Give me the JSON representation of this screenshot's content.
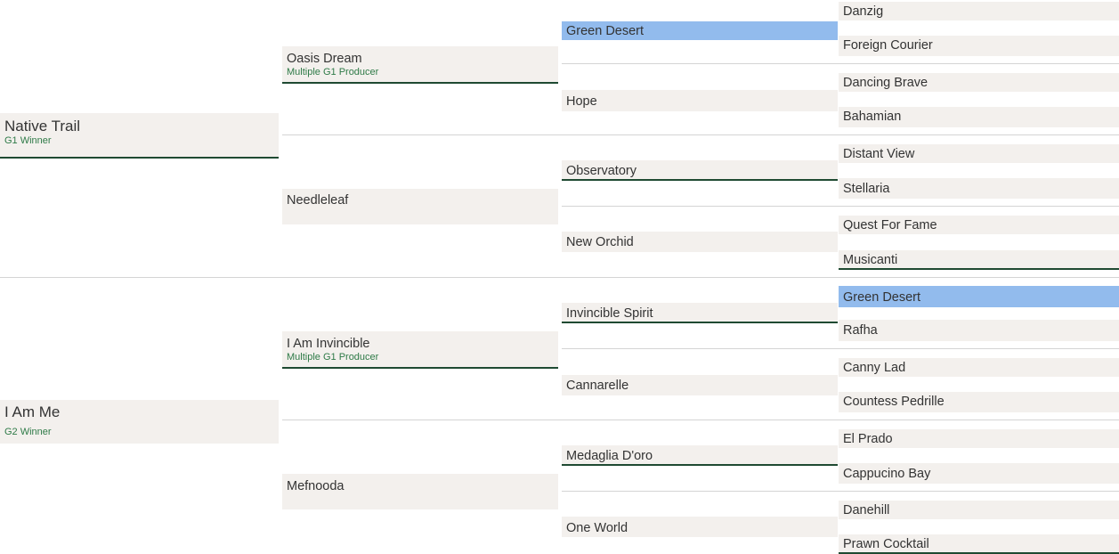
{
  "pedigree": {
    "sire": {
      "name": "Native Trail",
      "note": "G1 Winner"
    },
    "dam": {
      "name": "I Am Me",
      "note": "G2 Winner"
    },
    "sire_sire": {
      "name": "Oasis Dream",
      "note": "Multiple G1 Producer"
    },
    "sire_dam": {
      "name": "Needleleaf"
    },
    "dam_sire": {
      "name": "I Am Invincible",
      "note": "Multiple G1 Producer"
    },
    "dam_dam": {
      "name": "Mefnooda"
    },
    "generation3": [
      {
        "name": "Green Desert"
      },
      {
        "name": "Hope"
      },
      {
        "name": "Observatory"
      },
      {
        "name": "New Orchid"
      },
      {
        "name": "Invincible Spirit"
      },
      {
        "name": "Cannarelle"
      },
      {
        "name": "Medaglia D'oro"
      },
      {
        "name": "One World"
      }
    ],
    "generation4": [
      {
        "name": "Danzig"
      },
      {
        "name": "Foreign Courier"
      },
      {
        "name": "Dancing Brave"
      },
      {
        "name": "Bahamian"
      },
      {
        "name": "Distant View"
      },
      {
        "name": "Stellaria"
      },
      {
        "name": "Quest For Fame"
      },
      {
        "name": "Musicanti"
      },
      {
        "name": "Green Desert"
      },
      {
        "name": "Rafha"
      },
      {
        "name": "Canny Lad"
      },
      {
        "name": "Countess Pedrille"
      },
      {
        "name": "El Prado"
      },
      {
        "name": "Cappucino Bay"
      },
      {
        "name": "Danehill"
      },
      {
        "name": "Prawn Cocktail"
      }
    ],
    "highlight_color": "#92bbed",
    "cell_color": "#f3f0ed",
    "accent_underline_color": "#1f4a32",
    "note_text_color": "#2e7a47"
  }
}
